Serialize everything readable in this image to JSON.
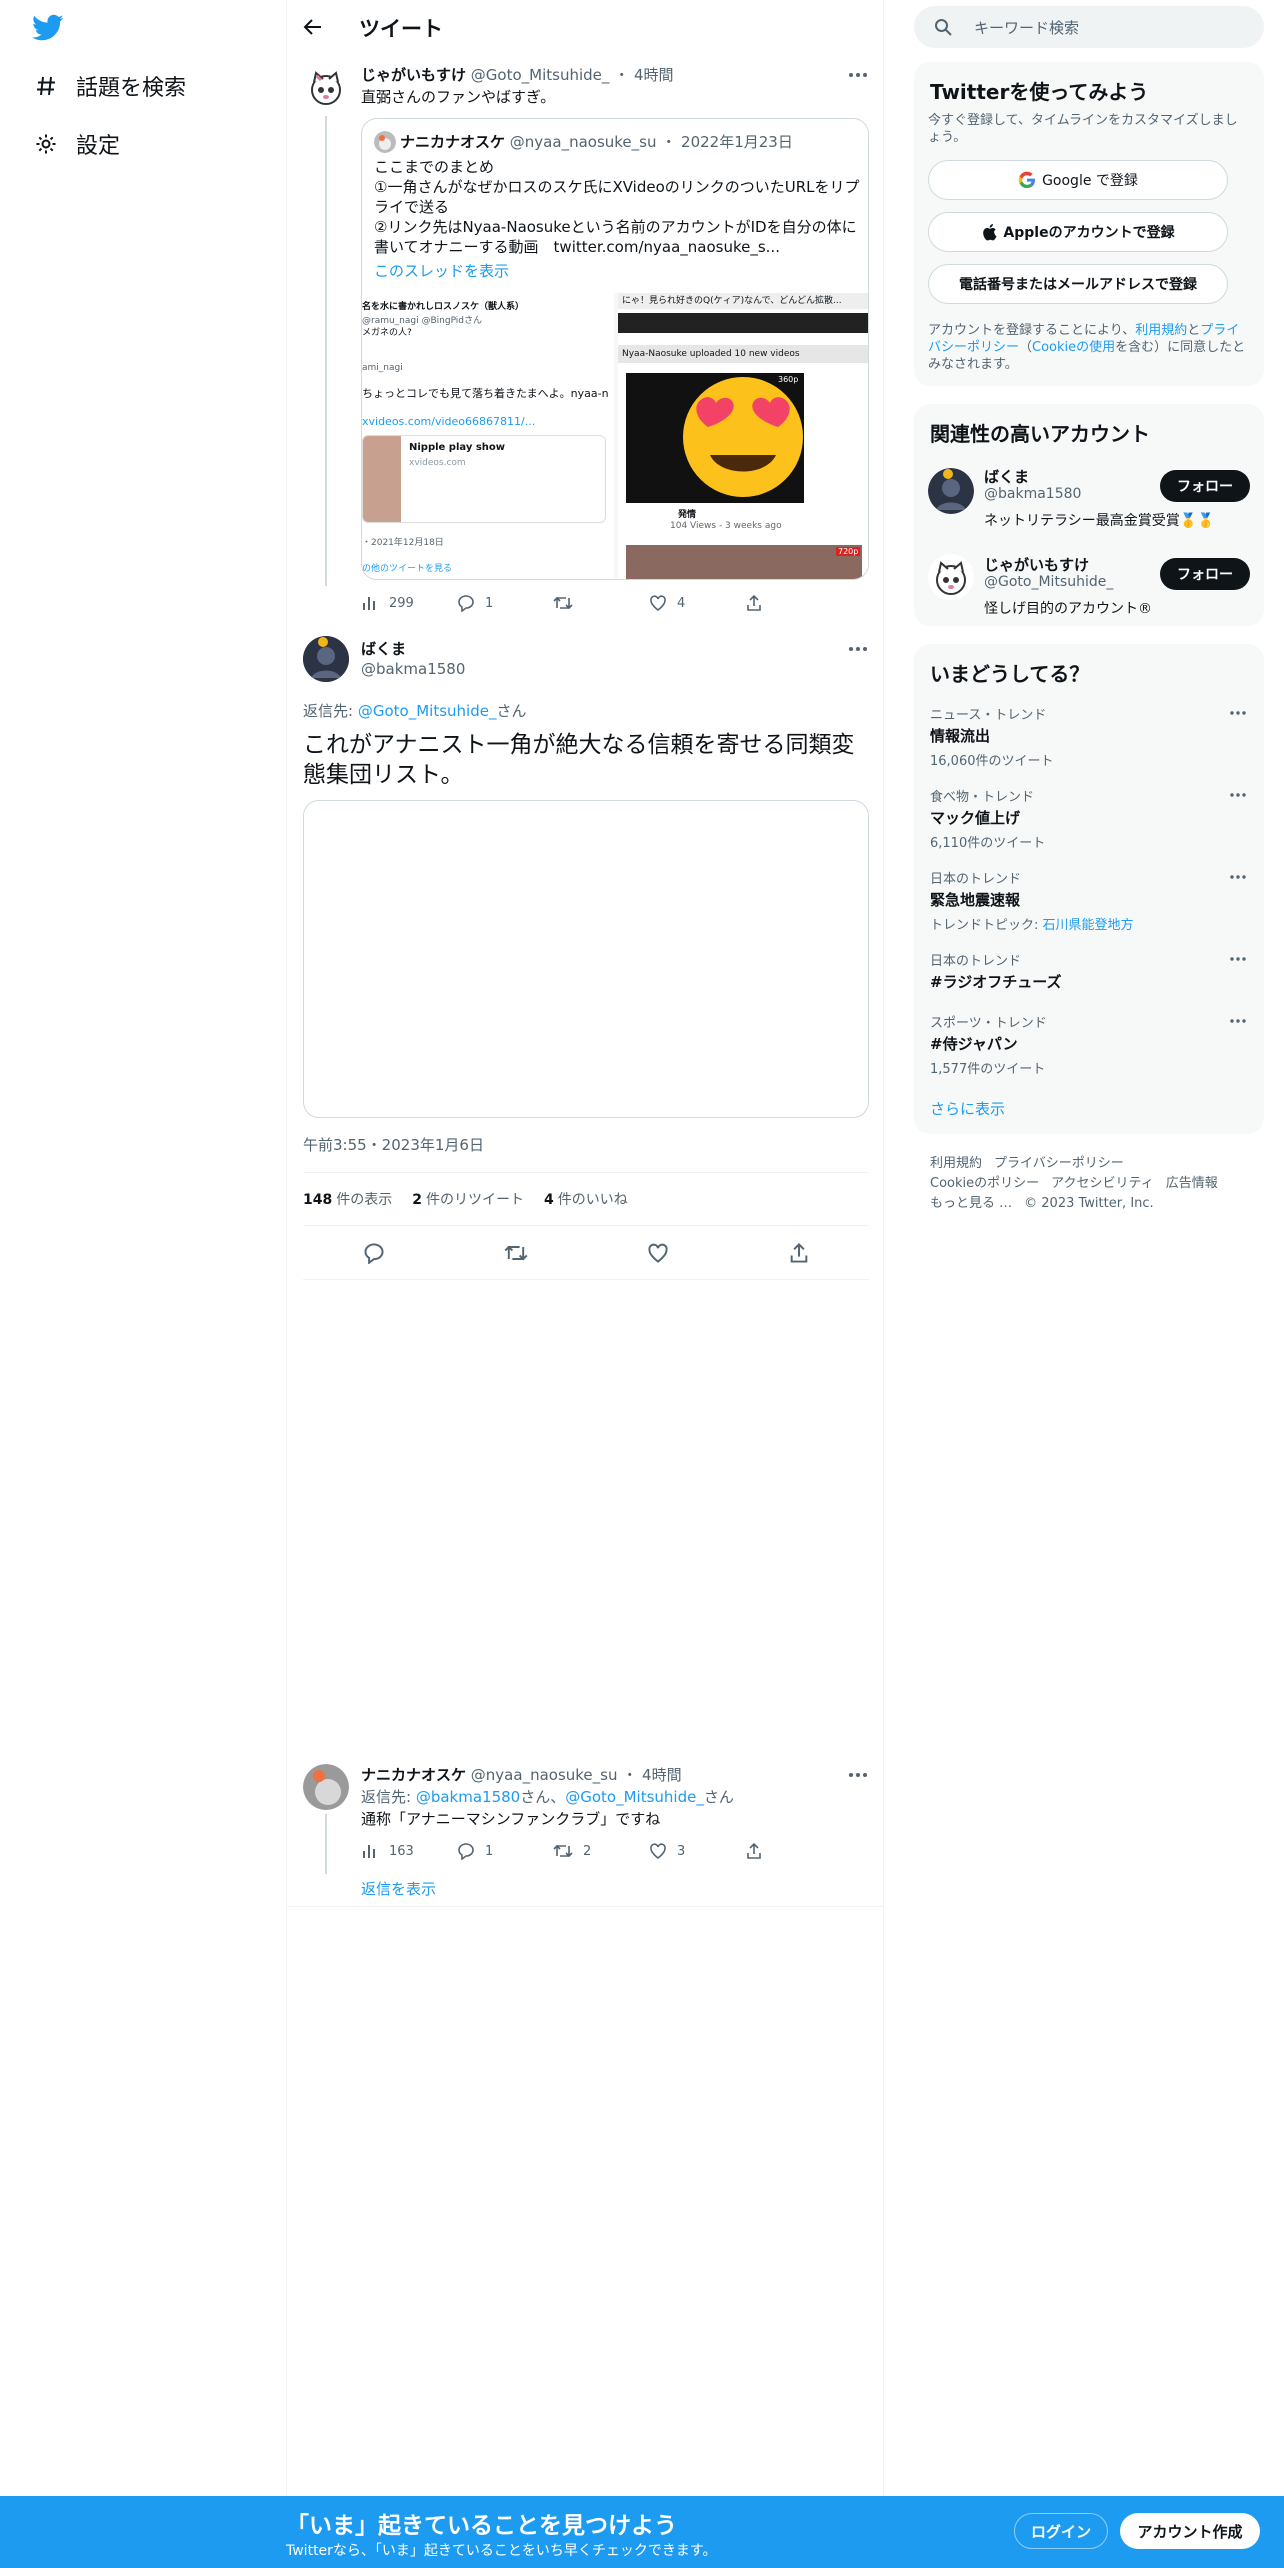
{
  "nav": {
    "items": [
      {
        "label": "話題を検索",
        "icon": "hashtag-icon"
      },
      {
        "label": "設定",
        "icon": "gear-icon"
      }
    ]
  },
  "header": {
    "title": "ツイート"
  },
  "tweet1": {
    "name": "じゃがいもすけ",
    "handle": "@Goto_Mitsuhide_",
    "time": "4時間",
    "text": "直弼さんのファンやばすぎ。",
    "quote": {
      "name": "ナニカナオスケ",
      "handle": "@nyaa_naosuke_su",
      "date": "2022年1月23日",
      "lines": [
        "ここまでのまとめ",
        "①一角さんがなぜかロスのスケ氏にXVideoのリンクのついたURLをリプ",
        "ライで送る",
        "②リンク先はNyaa-Naosukeという名前のアカウントがIDを自分の体に",
        "書いてオナニーする動画　twitter.com/nyaa_naosuke_s..."
      ],
      "show_thread": "このスレッドを表示",
      "media_left": {
        "title": "名を水に書かれしロスノスケ（獣人系）",
        "sub": "@ramu_nagi @BingPidさん",
        "line2": "メガネの人?",
        "user": "ami_nagi",
        "text": "ちょっとコレでも見て落ち着きたまへよ。nyaa-n",
        "link": "xvideos.com/video66867811/...",
        "card_title": "Nipple play show",
        "card_domain": "xvideos.com",
        "date": "・2021年12月18日",
        "more": "の他のツイートを見る"
      },
      "media_right": {
        "top": "にゃ！見られ好きのQ(ケィア)なんで、どんどん拡散...",
        "uploaded": "Nyaa-Naosuke uploaded 10 new videos",
        "badge": "360p",
        "caption": "発情",
        "views": "104 Views - 3 weeks ago",
        "badge2": "720p"
      }
    },
    "stats": {
      "views": "299",
      "replies": "1",
      "retweets": "",
      "likes": "4"
    }
  },
  "tweet2": {
    "name": "ばくま",
    "handle": "@bakma1580",
    "reply_prefix": "返信先:",
    "reply_to": "@Goto_Mitsuhide_",
    "reply_suffix": "さん",
    "text": "これがアナニスト一角が絶大なる信頼を寄せる同類変態集団リスト。",
    "timestamp": "午前3:55・2023年1月6日",
    "views_num": "148",
    "views_label": "件の表示",
    "rt_num": "2",
    "rt_label": "件のリツイート",
    "likes_num": "4",
    "likes_label": "件のいいね"
  },
  "tweet3": {
    "name": "ナニカナオスケ",
    "handle": "@nyaa_naosuke_su",
    "time": "4時間",
    "reply_prefix": "返信先:",
    "reply_to1": "@bakma1580",
    "reply_mid": "さん、",
    "reply_to2": "@Goto_Mitsuhide_",
    "reply_suffix": "さん",
    "text": "通称「アナニーマシンファンクラブ」ですね",
    "stats": {
      "views": "163",
      "replies": "1",
      "retweets": "2",
      "likes": "3"
    },
    "show_replies": "返信を表示"
  },
  "sidebar": {
    "search_placeholder": "キーワード検索",
    "signup": {
      "title": "Twitterを使ってみよう",
      "subtitle": "今すぐ登録して、タイムラインをカスタマイズしましょう。",
      "google": "Google で登録",
      "apple": "Appleのアカウントで登録",
      "phone": "電話番号またはメールアドレスで登録",
      "legal_1": "アカウントを登録することにより、",
      "legal_terms": "利用規約",
      "legal_2": "と",
      "legal_privacy": "プライバシーポリシー",
      "legal_3": "（",
      "legal_cookie": "Cookieの使用",
      "legal_4": "を含む）に同意したとみなされます。"
    },
    "related": {
      "title": "関連性の高いアカウント",
      "accounts": [
        {
          "name": "ばくま",
          "handle": "@bakma1580",
          "bio": "ネットリテラシー最高金賞受賞🥇🥇",
          "follow": "フォロー"
        },
        {
          "name": "じゃがいもすけ",
          "handle": "@Goto_Mitsuhide_",
          "bio": "怪しげ目的のアカウント®",
          "follow": "フォロー"
        }
      ]
    },
    "trends": {
      "title": "いまどうしてる？",
      "items": [
        {
          "category": "ニュース・トレンド",
          "title": "情報流出",
          "count": "16,060件のツイート"
        },
        {
          "category": "食べ物・トレンド",
          "title": "マック値上げ",
          "count": "6,110件のツイート"
        },
        {
          "category": "日本のトレンド",
          "title": "緊急地震速報",
          "count_prefix": "トレンドトピック:",
          "count_link": "石川県能登地方"
        },
        {
          "category": "日本のトレンド",
          "title": "#ラジオフチューズ",
          "count": ""
        },
        {
          "category": "スポーツ・トレンド",
          "title": "#侍ジャパン",
          "count": "1,577件のツイート"
        }
      ],
      "show_more": "さらに表示"
    },
    "footer": [
      "利用規約",
      "プライバシーポリシー",
      "Cookieのポリシー",
      "アクセシビリティ",
      "広告情報",
      "もっと見る …",
      "© 2023 Twitter, Inc."
    ]
  },
  "banner": {
    "title": "「いま」起きていることを見つけよう",
    "subtitle": "Twitterなら、「いま」起きていることをいち早くチェックできます。",
    "login": "ログイン",
    "signup": "アカウント作成"
  },
  "colors": {
    "accent": "#1d9bf0",
    "text": "#0f1419",
    "muted": "#536471",
    "border": "#cfd9de"
  }
}
